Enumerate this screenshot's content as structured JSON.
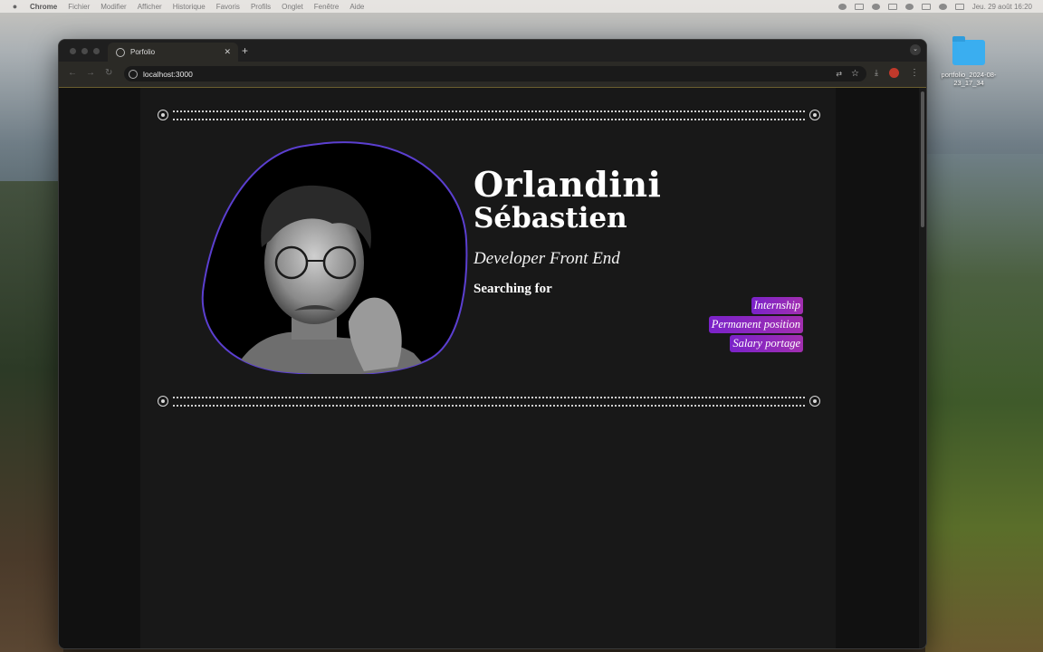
{
  "menubar": {
    "app": "Chrome",
    "items": [
      "Fichier",
      "Modifier",
      "Afficher",
      "Historique",
      "Favoris",
      "Profils",
      "Onglet",
      "Fenêtre",
      "Aide"
    ],
    "clock": "Jeu. 29 août  16:20"
  },
  "desktop": {
    "folder_label": "portfolio_2024-08-23_17_34"
  },
  "browser": {
    "tab_title": "Porfolio",
    "url": "localhost:3000"
  },
  "portfolio": {
    "first_name": "Orlandini",
    "last_name": "Sébastien",
    "role": "Developer Front End",
    "searching_label": "Searching for",
    "searching_items": [
      "Internship",
      "Permanent position",
      "Salary portage"
    ],
    "accent_color": "#7a22c9",
    "blob_border_color": "#5b3fd0"
  }
}
